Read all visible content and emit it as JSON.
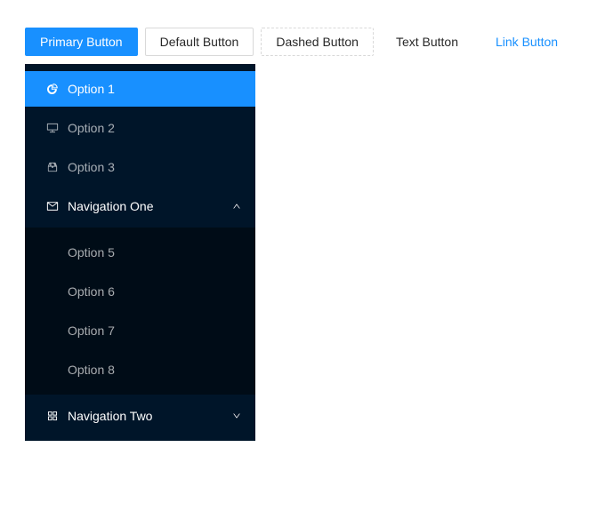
{
  "colors": {
    "primary": "#1890ff",
    "sider_bg": "#001529",
    "submenu_bg": "#000c17",
    "border": "#d9d9d9",
    "text": "rgba(0,0,0,0.85)",
    "menu_text": "rgba(255,255,255,0.65)"
  },
  "buttons": [
    {
      "label": "Primary Button",
      "type": "primary"
    },
    {
      "label": "Default Button",
      "type": "default"
    },
    {
      "label": "Dashed Button",
      "type": "dashed"
    },
    {
      "label": "Text Button",
      "type": "text"
    },
    {
      "label": "Link Button",
      "type": "link"
    }
  ],
  "menu": {
    "items": [
      {
        "label": "Option 1",
        "icon": "pie-chart-icon",
        "selected": true
      },
      {
        "label": "Option 2",
        "icon": "desktop-icon",
        "selected": false
      },
      {
        "label": "Option 3",
        "icon": "inbox-icon",
        "selected": false
      }
    ],
    "submenus": [
      {
        "label": "Navigation One",
        "icon": "mail-icon",
        "arrow": "chevron-up-icon",
        "expanded": true,
        "children": [
          {
            "label": "Option 5"
          },
          {
            "label": "Option 6"
          },
          {
            "label": "Option 7"
          },
          {
            "label": "Option 8"
          }
        ]
      },
      {
        "label": "Navigation Two",
        "icon": "appstore-icon",
        "arrow": "chevron-down-icon",
        "expanded": false,
        "children": []
      }
    ]
  }
}
